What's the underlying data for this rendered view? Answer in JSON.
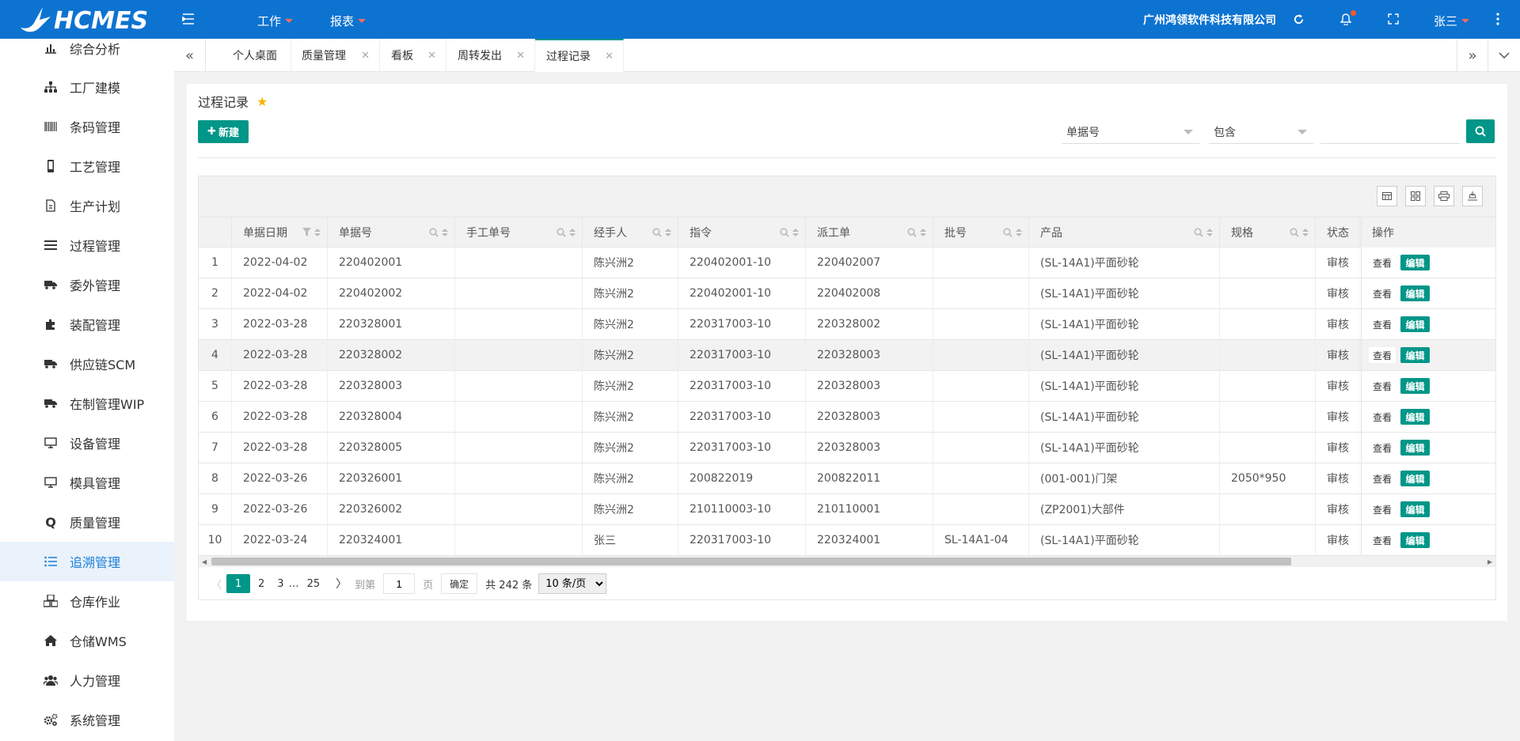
{
  "app": {
    "logo_text": "HCMES",
    "company": "广州鸿领软件科技有限公司",
    "user": "张三"
  },
  "top_menus": [
    {
      "label": "工作"
    },
    {
      "label": "报表"
    }
  ],
  "sidebar": {
    "items": [
      {
        "label": "综合分析",
        "icon": "bar-chart-icon"
      },
      {
        "label": "工厂建模",
        "icon": "sitemap-icon"
      },
      {
        "label": "条码管理",
        "icon": "barcode-icon"
      },
      {
        "label": "工艺管理",
        "icon": "phone-icon"
      },
      {
        "label": "生产计划",
        "icon": "document-icon"
      },
      {
        "label": "过程管理",
        "icon": "list-icon"
      },
      {
        "label": "委外管理",
        "icon": "truck-icon"
      },
      {
        "label": "装配管理",
        "icon": "puzzle-icon"
      },
      {
        "label": "供应链SCM",
        "icon": "truck-icon"
      },
      {
        "label": "在制管理WIP",
        "icon": "truck-icon"
      },
      {
        "label": "设备管理",
        "icon": "monitor-icon"
      },
      {
        "label": "模具管理",
        "icon": "monitor-icon"
      },
      {
        "label": "质量管理",
        "icon": "q-icon"
      },
      {
        "label": "追溯管理",
        "icon": "list-ordered-icon",
        "active": true
      },
      {
        "label": "仓库作业",
        "icon": "cubes-icon"
      },
      {
        "label": "仓储WMS",
        "icon": "home-icon"
      },
      {
        "label": "人力管理",
        "icon": "users-icon"
      },
      {
        "label": "系统管理",
        "icon": "cogs-icon"
      }
    ]
  },
  "tabs": [
    {
      "label": "个人桌面",
      "closable": false
    },
    {
      "label": "质量管理",
      "closable": true
    },
    {
      "label": "看板",
      "closable": true
    },
    {
      "label": "周转发出",
      "closable": true
    },
    {
      "label": "过程记录",
      "closable": true,
      "active": true
    }
  ],
  "page": {
    "title": "过程记录",
    "new_button": "新建",
    "filter_field": "单据号",
    "filter_op": "包含",
    "filter_value": ""
  },
  "table": {
    "columns": [
      "单据日期",
      "单据号",
      "手工单号",
      "经手人",
      "指令",
      "派工单",
      "批号",
      "产品",
      "规格",
      "状态",
      "操作"
    ],
    "view_label": "查看",
    "edit_label": "编辑",
    "rows": [
      [
        "1",
        "2022-04-02",
        "220402001",
        "",
        "陈兴洲2",
        "220402001-10",
        "220402007",
        "",
        "(SL-14A1)平面砂轮",
        "",
        "审核"
      ],
      [
        "2",
        "2022-04-02",
        "220402002",
        "",
        "陈兴洲2",
        "220402001-10",
        "220402008",
        "",
        "(SL-14A1)平面砂轮",
        "",
        "审核"
      ],
      [
        "3",
        "2022-03-28",
        "220328001",
        "",
        "陈兴洲2",
        "220317003-10",
        "220328002",
        "",
        "(SL-14A1)平面砂轮",
        "",
        "审核"
      ],
      [
        "4",
        "2022-03-28",
        "220328002",
        "",
        "陈兴洲2",
        "220317003-10",
        "220328003",
        "",
        "(SL-14A1)平面砂轮",
        "",
        "审核"
      ],
      [
        "5",
        "2022-03-28",
        "220328003",
        "",
        "陈兴洲2",
        "220317003-10",
        "220328003",
        "",
        "(SL-14A1)平面砂轮",
        "",
        "审核"
      ],
      [
        "6",
        "2022-03-28",
        "220328004",
        "",
        "陈兴洲2",
        "220317003-10",
        "220328003",
        "",
        "(SL-14A1)平面砂轮",
        "",
        "审核"
      ],
      [
        "7",
        "2022-03-28",
        "220328005",
        "",
        "陈兴洲2",
        "220317003-10",
        "220328003",
        "",
        "(SL-14A1)平面砂轮",
        "",
        "审核"
      ],
      [
        "8",
        "2022-03-26",
        "220326001",
        "",
        "陈兴洲2",
        "200822019",
        "200822011",
        "",
        "(001-001)门架",
        "2050*950",
        "审核"
      ],
      [
        "9",
        "2022-03-26",
        "220326002",
        "",
        "陈兴洲2",
        "210110003-10",
        "210110001",
        "",
        "(ZP2001)大部件",
        "",
        "审核"
      ],
      [
        "10",
        "2022-03-24",
        "220324001",
        "",
        "张三",
        "220317003-10",
        "220324001",
        "SL-14A1-04",
        "(SL-14A1)平面砂轮",
        "",
        "审核"
      ]
    ]
  },
  "pager": {
    "pages": [
      "1",
      "2",
      "3",
      "…",
      "25"
    ],
    "current": "1",
    "goto_label": "到第",
    "goto_value": "1",
    "page_unit": "页",
    "ok": "确定",
    "total": "共 242 条",
    "page_size": "10 条/页"
  },
  "colors": {
    "topbar": "#0d73d1",
    "accent": "#009688",
    "active_side": "#1b7ed8"
  }
}
